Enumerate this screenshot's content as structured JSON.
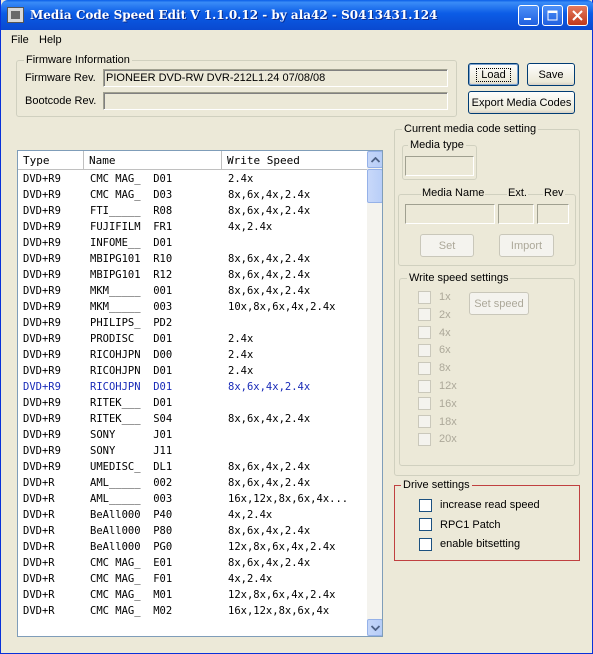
{
  "window": {
    "title": "Media Code Speed Edit V 1.1.0.12 - by ala42 - S0413431.124"
  },
  "menu": [
    {
      "label": "File"
    },
    {
      "label": "Help"
    }
  ],
  "firmware": {
    "group_label": "Firmware Information",
    "rev_label": "Firmware Rev.",
    "rev_value": "PIONEER DVD-RW  DVR-212L1.24 07/08/08",
    "bootcode_label": "Bootcode Rev.",
    "bootcode_value": ""
  },
  "buttons": {
    "load": "Load",
    "save": "Save",
    "export": "Export Media Codes"
  },
  "table": {
    "columns": [
      "Type",
      "Name",
      "Write Speed"
    ],
    "rows": [
      [
        "DVD+R9",
        "CMC MAG_  D01",
        "2.4x"
      ],
      [
        "DVD+R9",
        "CMC MAG_  D03",
        "8x,6x,4x,2.4x"
      ],
      [
        "DVD+R9",
        "FTI_____  R08",
        "8x,6x,4x,2.4x"
      ],
      [
        "DVD+R9",
        "FUJIFILM  FR1",
        "4x,2.4x"
      ],
      [
        "DVD+R9",
        "INFOME__  D01",
        ""
      ],
      [
        "DVD+R9",
        "MBIPG101  R10",
        "8x,6x,4x,2.4x"
      ],
      [
        "DVD+R9",
        "MBIPG101  R12",
        "8x,6x,4x,2.4x"
      ],
      [
        "DVD+R9",
        "MKM_____  001",
        "8x,6x,4x,2.4x"
      ],
      [
        "DVD+R9",
        "MKM_____  003",
        "10x,8x,6x,4x,2.4x"
      ],
      [
        "DVD+R9",
        "PHILIPS_  PD2",
        ""
      ],
      [
        "DVD+R9",
        "PRODISC   D01",
        "2.4x"
      ],
      [
        "DVD+R9",
        "RICOHJPN  D00",
        "2.4x"
      ],
      [
        "DVD+R9",
        "RICOHJPN  D01",
        "2.4x"
      ],
      [
        "DVD+R9",
        "RICOHJPN  D01",
        "8x,6x,4x,2.4x"
      ],
      [
        "DVD+R9",
        "RITEK___  D01",
        ""
      ],
      [
        "DVD+R9",
        "RITEK___  S04",
        "8x,6x,4x,2.4x"
      ],
      [
        "DVD+R9",
        "SONY      J01",
        ""
      ],
      [
        "DVD+R9",
        "SONY      J11",
        ""
      ],
      [
        "DVD+R9",
        "UMEDISC_  DL1",
        "8x,6x,4x,2.4x"
      ],
      [
        "DVD+R",
        "AML_____  002",
        "8x,6x,4x,2.4x"
      ],
      [
        "DVD+R",
        "AML_____  003",
        "16x,12x,8x,6x,4x..."
      ],
      [
        "DVD+R",
        "BeAll000  P40",
        "4x,2.4x"
      ],
      [
        "DVD+R",
        "BeAll000  P80",
        "8x,6x,4x,2.4x"
      ],
      [
        "DVD+R",
        "BeAll000  PG0",
        "12x,8x,6x,4x,2.4x"
      ],
      [
        "DVD+R",
        "CMC MAG_  E01",
        "8x,6x,4x,2.4x"
      ],
      [
        "DVD+R",
        "CMC MAG_  F01",
        "4x,2.4x"
      ],
      [
        "DVD+R",
        "CMC MAG_  M01",
        "12x,8x,6x,4x,2.4x"
      ],
      [
        "DVD+R",
        "CMC MAG_  M02",
        "16x,12x,8x,6x,4x"
      ]
    ]
  },
  "current": {
    "group_label": "Current media code setting",
    "media_type_label": "Media type",
    "media_name_label": "Media Name",
    "ext_label": "Ext.",
    "rev_label": "Rev",
    "set_label": "Set",
    "import_label": "Import"
  },
  "write_speed": {
    "group_label": "Write speed settings",
    "speeds": [
      "1x",
      "2x",
      "4x",
      "6x",
      "8x",
      "12x",
      "16x",
      "18x",
      "20x"
    ],
    "set_speed_label": "Set speed"
  },
  "drive": {
    "group_label": "Drive settings",
    "options": [
      "increase read speed",
      "RPC1 Patch",
      "enable bitsetting"
    ]
  }
}
